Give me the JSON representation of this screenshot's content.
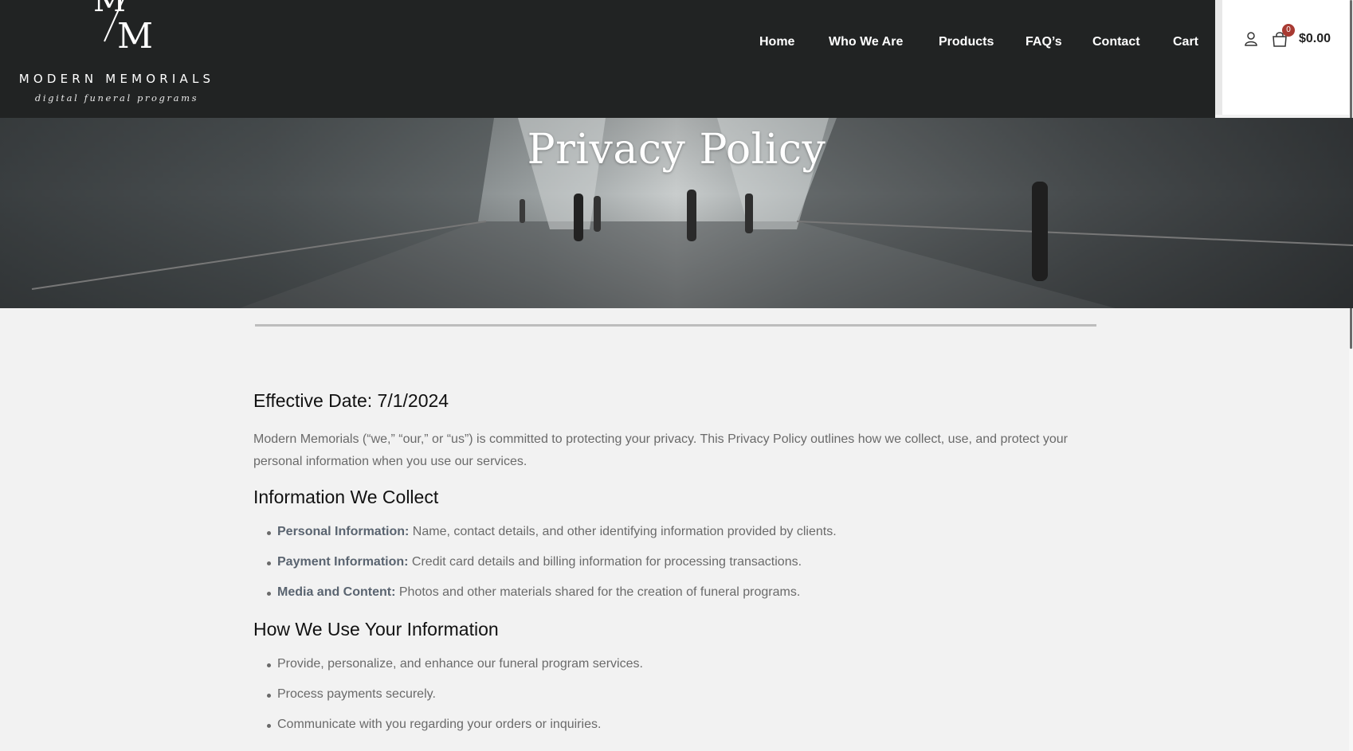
{
  "header": {
    "logo": {
      "name": "MODERN MEMORIALS",
      "tagline": "digital funeral programs",
      "mark": "MM"
    },
    "nav": [
      "Home",
      "Who We Are",
      "Products",
      "FAQ’s",
      "Contact",
      "Cart"
    ],
    "cart": {
      "count": "0",
      "total": "$0.00"
    },
    "icons": [
      "user-icon",
      "shopping-bag-icon"
    ]
  },
  "hero": {
    "title": "Privacy Policy"
  },
  "content": {
    "effective_date": "Effective Date: 7/1/2024",
    "intro": "Modern Memorials (“we,” “our,” or “us”) is committed to protecting your privacy. This Privacy Policy outlines how we collect, use, and protect your personal information when you use our services.",
    "collect": {
      "heading": "Information We Collect",
      "items": [
        {
          "label": "Personal Information:",
          "text": " Name, contact details, and other identifying information provided by clients."
        },
        {
          "label": "Payment Information:",
          "text": " Credit card details and billing information for processing transactions."
        },
        {
          "label": "Media and Content:",
          "text": " Photos and other materials shared for the creation of funeral programs."
        }
      ]
    },
    "use": {
      "heading": "How We Use Your Information",
      "items": [
        "Provide, personalize, and enhance our funeral program services.",
        "Process payments securely.",
        "Communicate with you regarding your orders or inquiries."
      ]
    }
  }
}
